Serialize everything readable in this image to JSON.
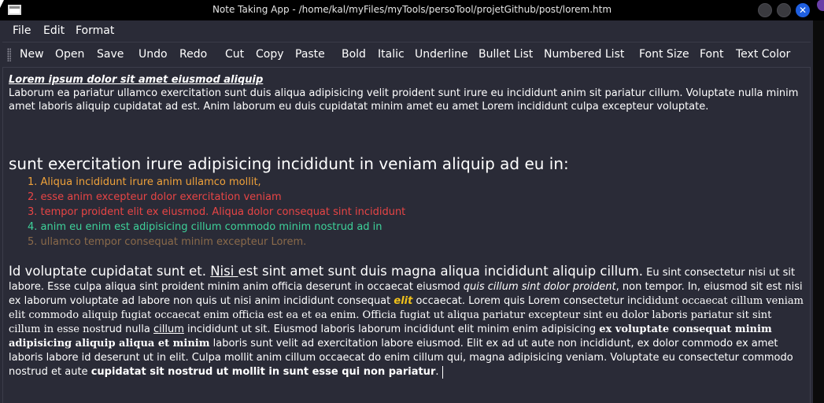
{
  "window": {
    "title": "Note Taking App - /home/kal/myFiles/myTools/persoTool/projetGithub/post/lorem.htm",
    "close_glyph": "✕"
  },
  "menu": [
    "File",
    "Edit",
    "Format"
  ],
  "toolbar": [
    "New",
    "Open",
    "Save",
    "Undo",
    "Redo",
    "Cut",
    "Copy",
    "Paste",
    "Bold",
    "Italic",
    "Underline",
    "Bullet List",
    "Numbered List",
    "Font Size",
    "Font",
    "Text Color"
  ],
  "document": {
    "heading": "Lorem ipsum dolor sit amet eiusmod aliquip",
    "para1": "Laborum ea pariatur ullamco exercitation sunt duis aliqua adipisicing velit proident sunt irure eu incididunt anim sit pariatur cillum. Voluptate nulla minim amet laboris aliquip cupidatat ad est. Anim laborum eu duis cupidatat minim amet eu amet Lorem incididunt culpa excepteur voluptate.",
    "big_heading": "sunt exercitation irure adipisicing incididunt in veniam aliquip ad eu in:",
    "list": [
      {
        "text": "1. Aliqua incididunt irure anim ullamco mollit,",
        "color": "#f0a23a"
      },
      {
        "text": "2. esse anim excepteur dolor exercitation veniam",
        "color": "#e84545"
      },
      {
        "text": "3. tempor proident elit ex eiusmod. Aliqua dolor consequat sint incididunt",
        "color": "#e84545"
      },
      {
        "text": "4. anim eu enim est adipisicing cillum commodo minim nostrud ad in",
        "color": "#3ed29a"
      },
      {
        "text": "5. ullamco tempor consequat minim excepteur Lorem.",
        "color": "#8a6a4a"
      }
    ],
    "para2": {
      "lead_a": "Id voluptate cupidatat sunt et. ",
      "lead_u": "Nisi ",
      "lead_b": "est sint amet sunt duis magna aliqua incididunt aliquip cillum.",
      "s1": " Eu sint consectetur nisi ut sit labore. Esse culpa aliqua sint proident minim anim officia deserunt in occaecat eiusmod ",
      "i1": "quis cillum sint dolor proident",
      "s2": ", non tempor. In, eiusmod sit est nisi ex laborum voluptate ad labore non quis ut nisi anim incididunt consequat ",
      "gold": "elit",
      "s3": " occaecat. Lorem quis Lorem consectetur inci",
      "serif1": "didunt occaecat cillum veniam elit commodo aliquip fugiat occaecat enim officia est ea et ea enim. Officia fugiat ut aliqua pariatur excepteur sint eu dolor laboris pariatur sit sint cillum in esse nost",
      "s4": "rud nulla ",
      "u2": "cillum",
      "s5": " incididunt ut sit. Eiusmod laboris laborum incididunt elit minim enim adipisicing ",
      "serif2": "ex voluptate consequat minim adipisicing aliquip aliqua et minim",
      "s6": " laboris sunt velit ad exercitation labore eiusmod. Elit ex ad ut aute non incididunt, ex dolor commodo ex amet laboris labore id deserunt ut in elit. Culpa mollit anim cillum occaecat do enim cillum qui, magna adipisicing veniam. Voluptate eu consectetur commodo nostrud et aute ",
      "bold": "cupidatat sit nostrud ut mollit in sunt esse qui non pariatur",
      "end": "."
    }
  },
  "colors": {
    "background": "#2a2b37",
    "titlebar": "#000000",
    "close_button": "#1f5fe0"
  }
}
